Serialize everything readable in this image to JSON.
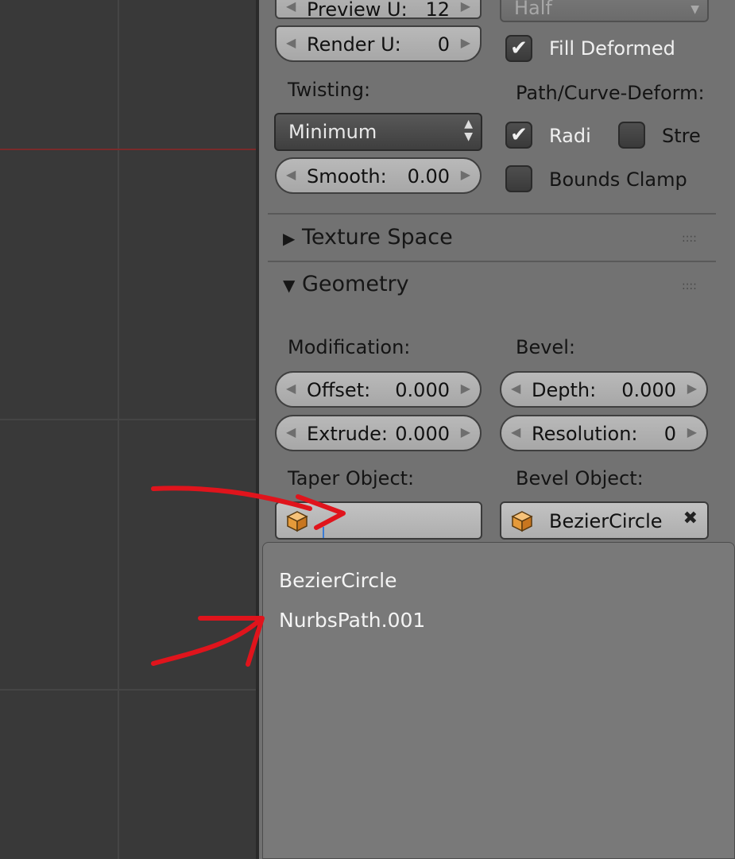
{
  "curve_shape": {
    "preview_u": {
      "label": "Preview U:",
      "value": "12"
    },
    "render_u": {
      "label": "Render U:",
      "value": "0"
    },
    "fill_mode": "Half",
    "fill_deformed": {
      "label": "Fill Deformed",
      "checked": true
    },
    "twisting": {
      "label": "Twisting:",
      "selected": "Minimum"
    },
    "smooth": {
      "label": "Smooth:",
      "value": "0.00"
    },
    "path_curve_deform": {
      "label": "Path/Curve-Deform:",
      "radius": {
        "label": "Radi",
        "checked": true
      },
      "stretch": {
        "label": "Stre",
        "checked": false
      },
      "bounds_clamp": {
        "label": "Bounds Clamp",
        "checked": false
      }
    }
  },
  "texture_space": {
    "title": "Texture Space",
    "expanded": false,
    "grip": "::::"
  },
  "geometry": {
    "title": "Geometry",
    "expanded": true,
    "grip": "::::",
    "modification": {
      "label": "Modification:",
      "offset": {
        "label": "Offset:",
        "value": "0.000"
      },
      "extrude": {
        "label": "Extrude:",
        "value": "0.000"
      }
    },
    "bevel": {
      "label": "Bevel:",
      "depth": {
        "label": "Depth:",
        "value": "0.000"
      },
      "resolution": {
        "label": "Resolution:",
        "value": "0"
      }
    },
    "taper_object": {
      "label": "Taper Object:",
      "value": ""
    },
    "bevel_object": {
      "label": "Bevel Object:",
      "value": "BezierCircle"
    }
  },
  "object_dropdown": {
    "items": [
      "BezierCircle",
      "NurbsPath.001"
    ]
  },
  "icons": {
    "left_arrow": "◀",
    "right_arrow": "▶",
    "collapsed": "▶",
    "expanded": "▼",
    "checkmark": "✔",
    "up_down": "▲▼",
    "clear": "✖"
  },
  "colors": {
    "annotation_red": "#e0141c",
    "panel_bg": "#727272",
    "viewport_bg": "#393939",
    "cube_orange": "#e59a3a"
  }
}
